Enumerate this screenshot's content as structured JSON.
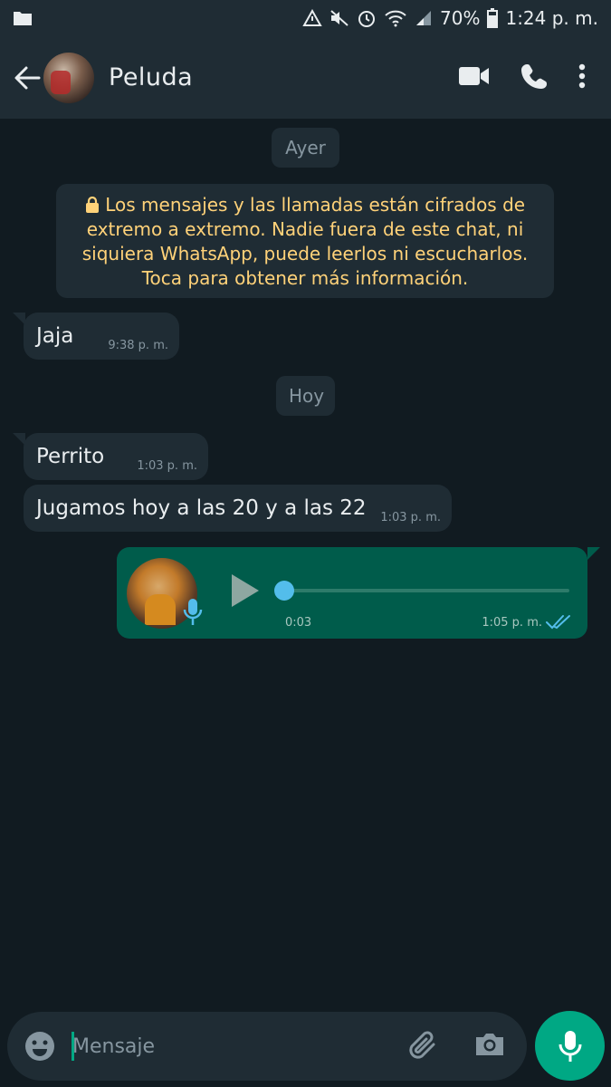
{
  "status_bar": {
    "battery": "70%",
    "time": "1:24 p. m.",
    "icons": [
      "folder-icon",
      "nfc-icon",
      "mute-icon",
      "alarm-icon",
      "wifi-icon",
      "signal-icon",
      "battery-icon"
    ]
  },
  "header": {
    "contact_name": "Peluda",
    "actions": [
      "video-call-icon",
      "phone-icon",
      "more-icon"
    ]
  },
  "chat": {
    "date_yesterday": "Ayer",
    "encryption_notice": "Los mensajes y las llamadas están cifrados de extremo a extremo. Nadie fuera de este chat, ni siquiera WhatsApp, puede leerlos ni escucharlos. Toca para obtener más información.",
    "date_today": "Hoy",
    "messages": [
      {
        "text": "Jaja",
        "time": "9:38 p. m."
      },
      {
        "text": "Perrito",
        "time": "1:03 p. m."
      },
      {
        "text": "Jugamos hoy a las 20 y a las 22",
        "time": "1:03 p. m."
      }
    ],
    "voice_note": {
      "duration": "0:03",
      "time": "1:05 p. m.",
      "status": "read",
      "progress": 0
    }
  },
  "composer": {
    "placeholder": "Mensaje"
  },
  "colors": {
    "background": "#111b21",
    "header": "#1f2c34",
    "bubble_in": "#1f2c34",
    "bubble_out": "#005c4b",
    "accent": "#00a884",
    "encryption_text": "#ffd279",
    "read_ticks": "#53bdeb"
  }
}
